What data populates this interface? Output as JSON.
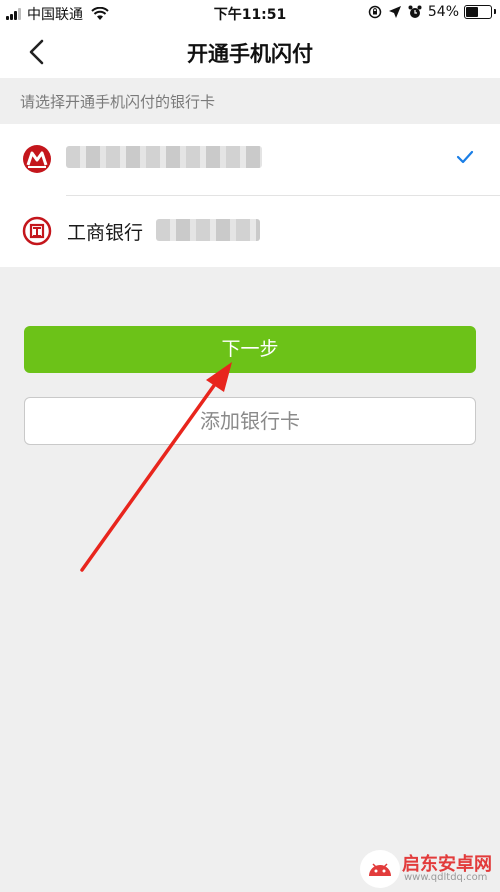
{
  "status_bar": {
    "carrier": "中国联通",
    "time": "下午11:51",
    "battery_percent": "54%",
    "battery_level": 0.54
  },
  "header": {
    "title": "开通手机闪付"
  },
  "section_hint": "请选择开通手机闪付的银行卡",
  "cards": [
    {
      "bank_name": "",
      "logo_icon": "cmb-bank-logo-icon",
      "selected": true
    },
    {
      "bank_name": "工商银行",
      "logo_icon": "icbc-bank-logo-icon",
      "selected": false
    }
  ],
  "actions": {
    "next_label": "下一步",
    "add_card_label": "添加银行卡"
  },
  "watermark": {
    "brand": "启东安卓网",
    "url": "www.qdltdq.com"
  },
  "colors": {
    "primary_green": "#6cc218",
    "check_blue": "#1a7ee6",
    "bank_red": "#c4161c",
    "arrow_red": "#e8251d"
  }
}
